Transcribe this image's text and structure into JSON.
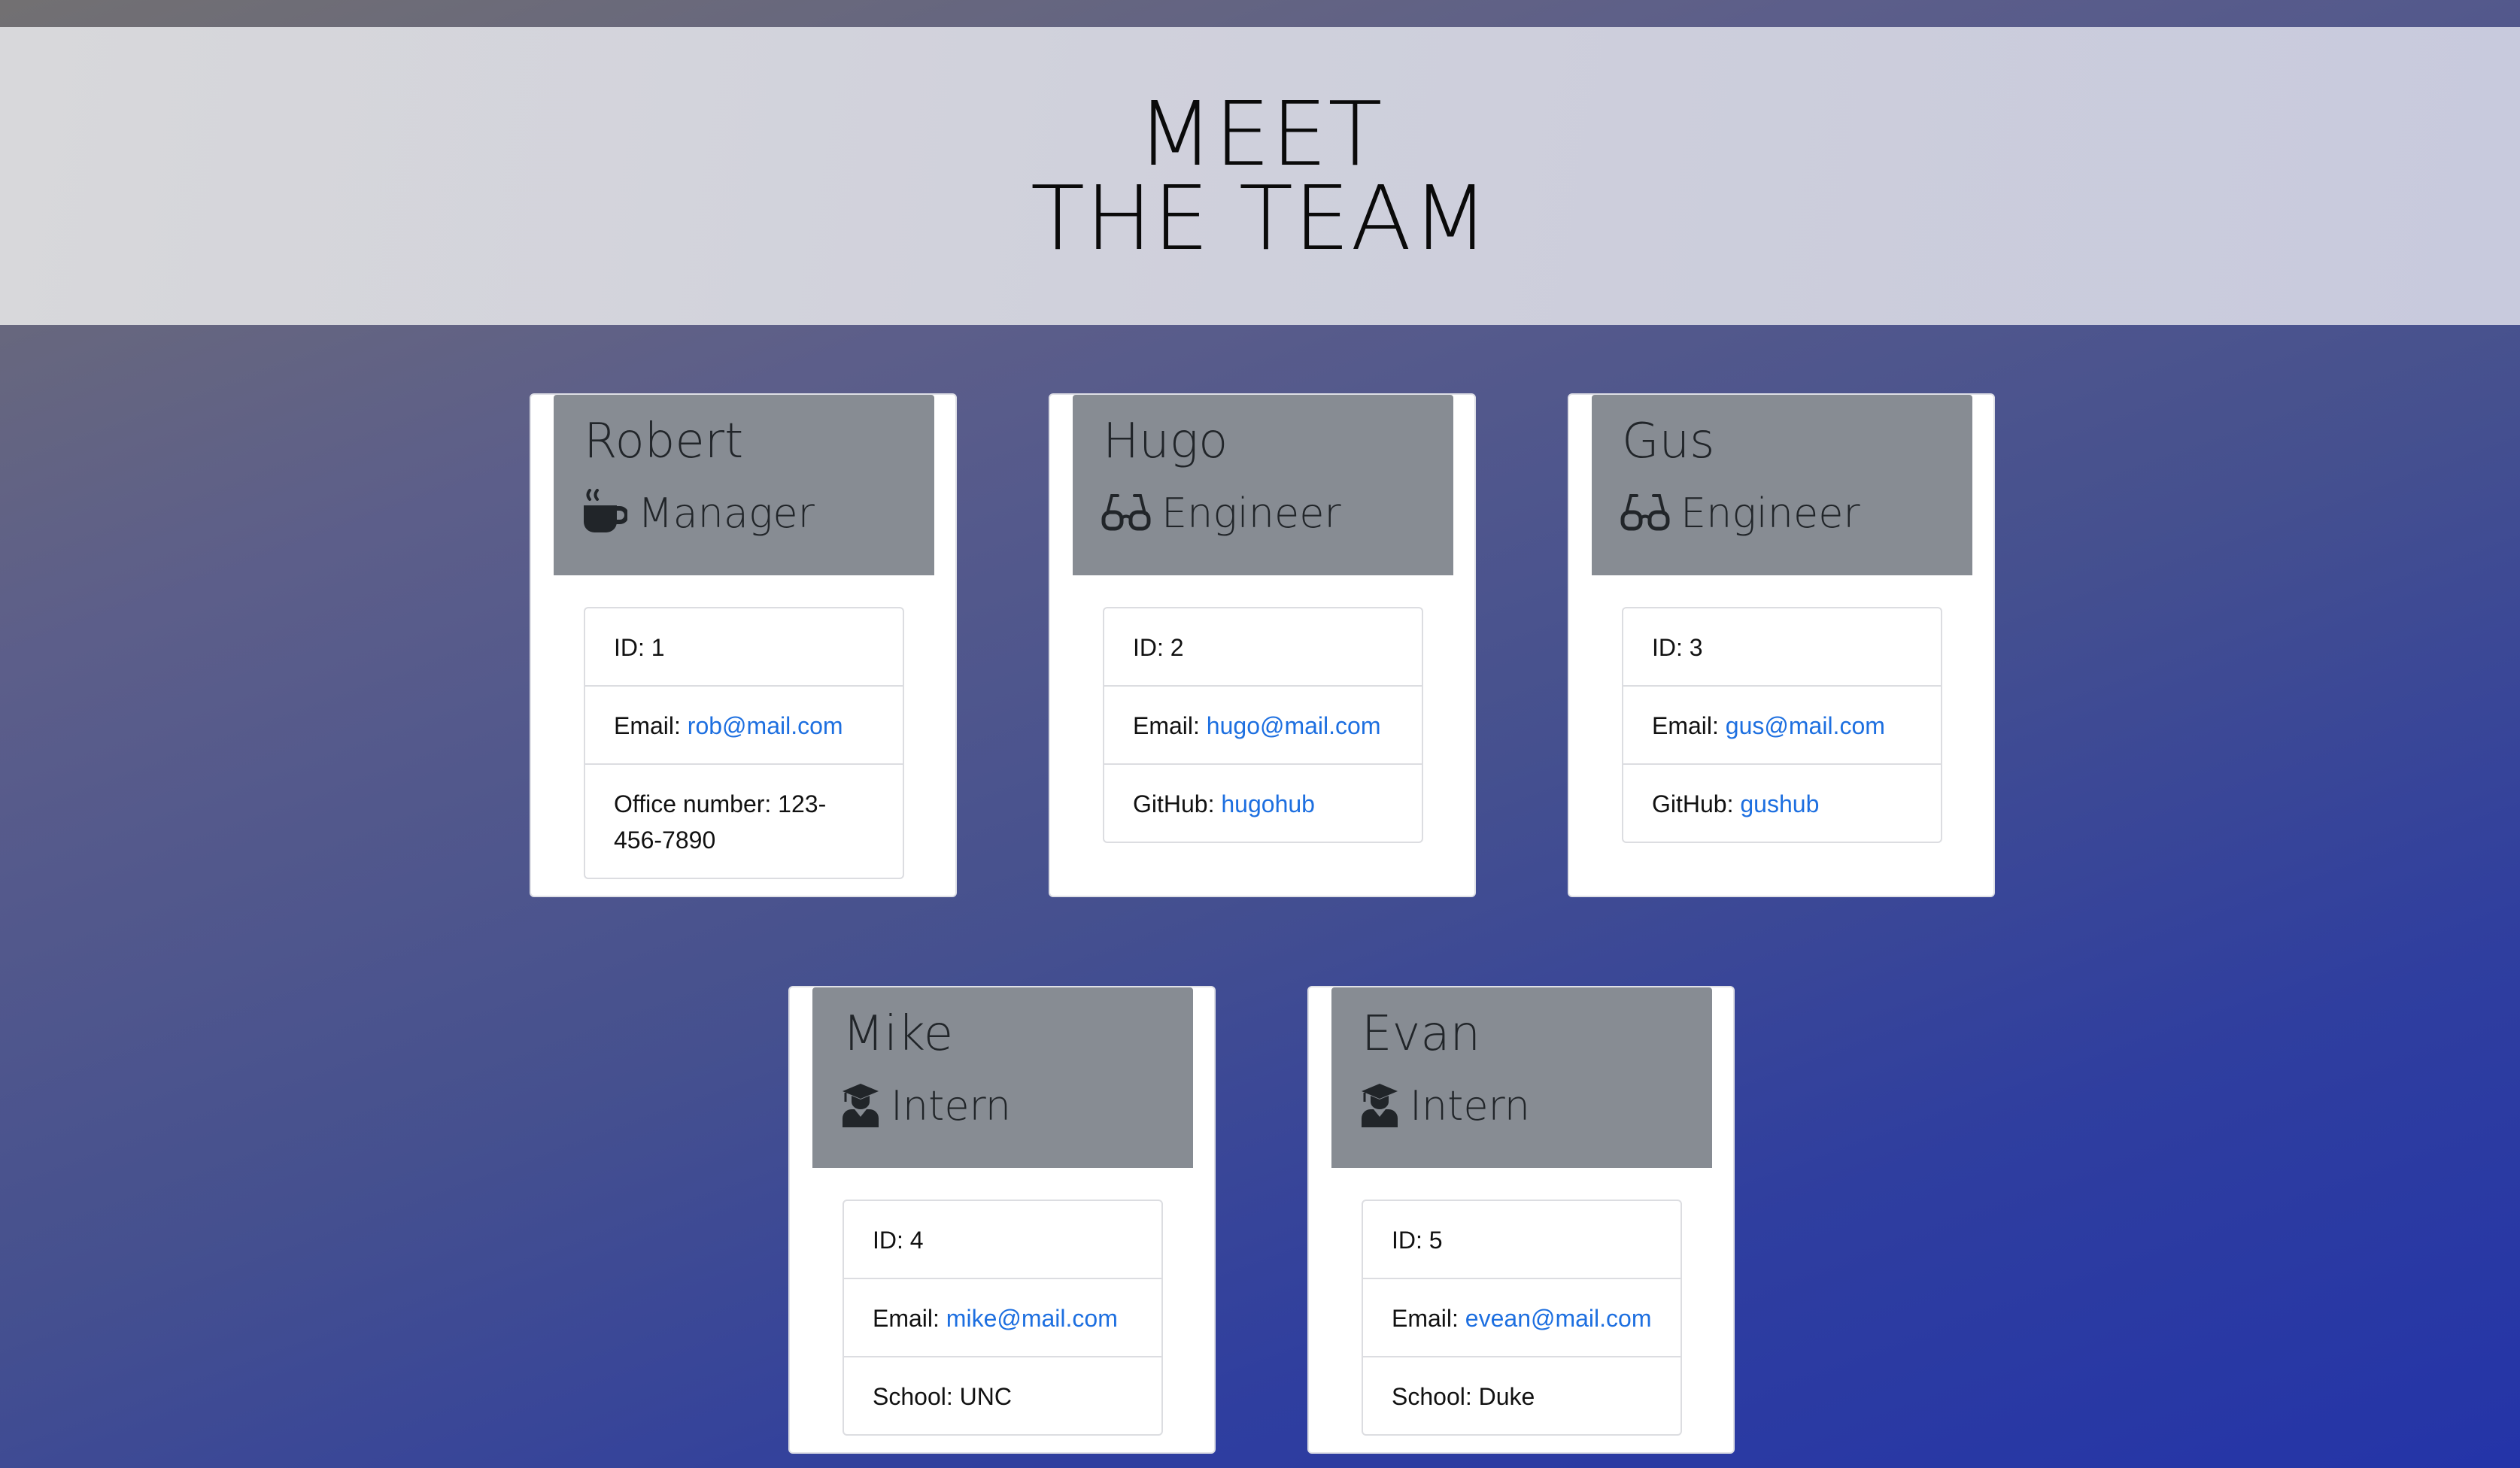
{
  "header": {
    "title_line1": "MEET",
    "title_line2": "THE TEAM"
  },
  "colors": {
    "card_header_bg": "#878c93",
    "link": "#1d6fe0",
    "jumbotron_bg": "#d0d1dc"
  },
  "employees": [
    {
      "name": "Robert",
      "role": "Manager",
      "role_icon": "coffee-mug-icon",
      "id_label": "ID:",
      "id": "1",
      "email_label": "Email:",
      "email": "rob@mail.com",
      "extra_label": "Office number:",
      "extra_value": "123-456-7890"
    },
    {
      "name": "Hugo",
      "role": "Engineer",
      "role_icon": "glasses-icon",
      "id_label": "ID:",
      "id": "2",
      "email_label": "Email:",
      "email": "hugo@mail.com",
      "extra_label": "GitHub:",
      "extra_value": "hugohub"
    },
    {
      "name": "Gus",
      "role": "Engineer",
      "role_icon": "glasses-icon",
      "id_label": "ID:",
      "id": "3",
      "email_label": "Email:",
      "email": "gus@mail.com",
      "extra_label": "GitHub:",
      "extra_value": "gushub"
    },
    {
      "name": "Mike",
      "role": "Intern",
      "role_icon": "graduate-icon",
      "id_label": "ID:",
      "id": "4",
      "email_label": "Email:",
      "email": "mike@mail.com",
      "extra_label": "School:",
      "extra_value": "UNC"
    },
    {
      "name": "Evan",
      "role": "Intern",
      "role_icon": "graduate-icon",
      "id_label": "ID:",
      "id": "5",
      "email_label": "Email:",
      "email": "evean@mail.com",
      "extra_label": "School:",
      "extra_value": "Duke"
    }
  ]
}
